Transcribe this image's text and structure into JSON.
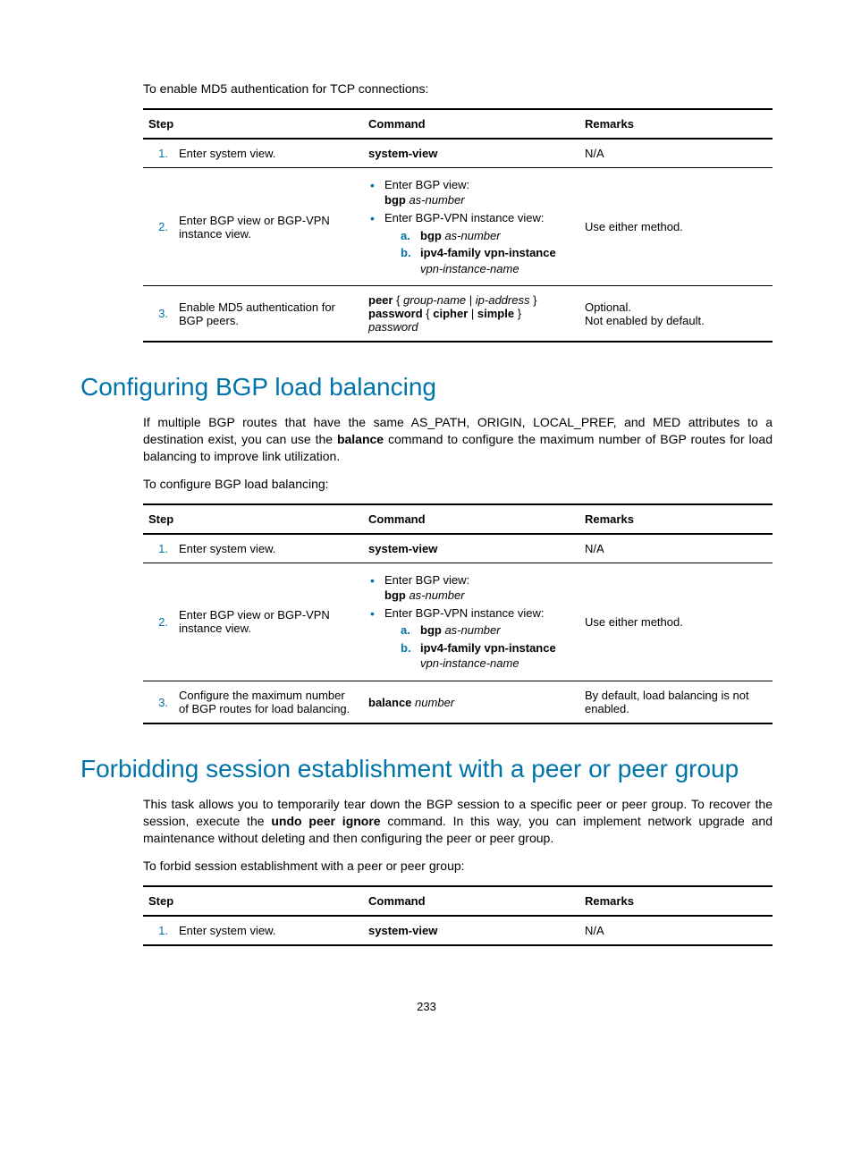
{
  "intro1": "To enable MD5 authentication for TCP connections:",
  "t1": {
    "h_step": "Step",
    "h_cmd": "Command",
    "h_rem": "Remarks",
    "r1": {
      "n": "1.",
      "step": "Enter system view.",
      "cmd": "system-view",
      "rem": "N/A"
    },
    "r2": {
      "n": "2.",
      "step": "Enter BGP view or BGP-VPN instance view.",
      "b1a": "Enter BGP view:",
      "b1b_bold": "bgp",
      "b1b_it": "as-number",
      "b2a": "Enter BGP-VPN instance view:",
      "s_a_lbl": "a.",
      "s_a_bold": "bgp",
      "s_a_it": "as-number",
      "s_b_lbl": "b.",
      "s_b_bold": "ipv4-family vpn-instance",
      "s_b_it": "vpn-instance-name",
      "rem": "Use either method."
    },
    "r3": {
      "n": "3.",
      "step": "Enable MD5 authentication for BGP peers.",
      "c_peer": "peer",
      "c_brace_o": " { ",
      "c_gn": "group-name",
      "c_pipe": " | ",
      "c_ip": "ip-address",
      "c_brace_c": " } ",
      "c_pw": "password",
      "c_cipher": "cipher",
      "c_simple": "simple",
      "c_pwit": "password",
      "rem1": "Optional.",
      "rem2": "Not enabled by default."
    }
  },
  "h_bal": "Configuring BGP load balancing",
  "p_bal1a": "If multiple BGP routes that have the same AS_PATH, ORIGIN, LOCAL_PREF, and MED attributes to a destination exist, you can use the ",
  "p_bal1b": "balance",
  "p_bal1c": " command to configure the maximum number of BGP routes for load balancing to improve link utilization.",
  "p_bal2": "To configure BGP load balancing:",
  "t2": {
    "r3": {
      "n": "3.",
      "step": "Configure the maximum number of BGP routes for load balancing.",
      "c_bold": "balance",
      "c_it": "number",
      "rem": "By default, load balancing is not enabled."
    }
  },
  "h_forbid": "Forbidding session establishment with a peer or peer group",
  "p_f1a": "This task allows you to temporarily tear down the BGP session to a specific peer or peer group. To recover the session, execute the ",
  "p_f1b": "undo peer ignore",
  "p_f1c": " command. In this way, you can implement network upgrade and maintenance without deleting and then configuring the peer or peer group.",
  "p_f2": "To forbid session establishment with a peer or peer group:",
  "pagenum": "233"
}
